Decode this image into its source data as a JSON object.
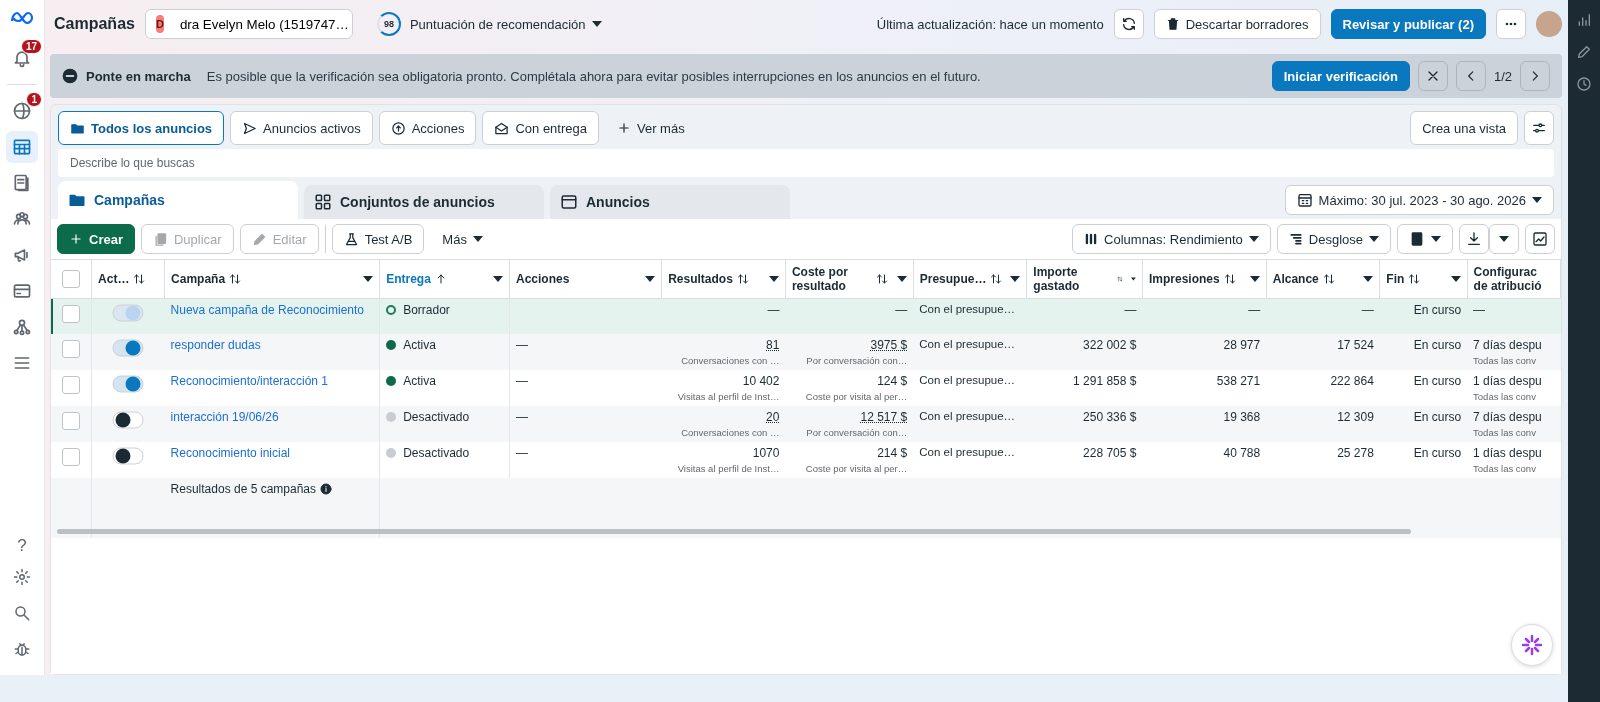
{
  "sidebar": {
    "items": [
      {
        "badge": "17",
        "selected": false
      },
      {
        "badge": "1",
        "selected": false
      },
      {
        "selected": true
      },
      {
        "selected": false
      },
      {
        "selected": false
      },
      {
        "selected": false
      },
      {
        "selected": false
      },
      {
        "selected": false
      },
      {
        "selected": false
      }
    ],
    "help_label": "?"
  },
  "header": {
    "title": "Campañas",
    "account": {
      "badge": "D",
      "name": "dra Evelyn Melo (1519747…"
    },
    "score": "98",
    "score_label": "Puntuación de recomendación",
    "updated": "Última actualización: hace un momento",
    "discard": "Descartar borradores",
    "publish": "Revisar y publicar (2)"
  },
  "banner": {
    "title": "Ponte en marcha",
    "message": "Es posible que la verificación sea obligatoria pronto. Complétala ahora para evitar posibles interrupciones en los anuncios en el futuro.",
    "action": "Iniciar verificación",
    "pager": "1/2"
  },
  "view_tabs": [
    {
      "label": "Todos los anuncios",
      "selected": true
    },
    {
      "label": "Anuncios activos",
      "selected": false
    },
    {
      "label": "Acciones",
      "selected": false
    },
    {
      "label": "Con entrega",
      "selected": false
    }
  ],
  "see_more": "Ver más",
  "create_view": "Crea una vista",
  "search": {
    "placeholder": "Describe lo que buscas"
  },
  "level_tabs": [
    {
      "label": "Campañas",
      "selected": true
    },
    {
      "label": "Conjuntos de anuncios",
      "selected": false
    },
    {
      "label": "Anuncios",
      "selected": false
    }
  ],
  "date_range": "Máximo: 30 jul. 2023 - 30 ago. 2026",
  "toolbar": {
    "create": "Crear",
    "buttons": [
      {
        "label": "Duplicar",
        "disabled": true
      },
      {
        "label": "Editar",
        "disabled": true
      },
      {
        "label": "Test A/B",
        "disabled": false
      }
    ],
    "more": "Más",
    "columns": "Columnas: Rendimiento",
    "breakdown": "Desglose"
  },
  "table": {
    "select_all_checked": false,
    "columns": [
      {
        "label": "Act…",
        "sorted": false
      },
      {
        "label": "Campaña",
        "sorted": false
      },
      {
        "label": "Entrega",
        "sorted": true
      },
      {
        "label": "Acciones",
        "sorted": false
      },
      {
        "label": "Resultados",
        "sorted": false
      },
      {
        "label": "Coste por resultado",
        "sorted": false
      },
      {
        "label": "Presupue…",
        "sorted": false
      },
      {
        "label": "Importe gastado",
        "sorted": false
      },
      {
        "label": "Impresiones",
        "sorted": false
      },
      {
        "label": "Alcance",
        "sorted": false
      },
      {
        "label": "Fin",
        "sorted": false
      },
      {
        "label": "Configurac de atribució",
        "sorted": false
      }
    ],
    "rows": [
      {
        "highlighted": true,
        "checked": false,
        "on": true,
        "draft": true,
        "name": "Nueva campaña de Reconocimiento",
        "status": "Borrador",
        "hollow_dot": true,
        "color": "#1e7a5a",
        "actions": "",
        "results": {
          "value": "—",
          "underlined": false
        },
        "cost": {
          "value": "—",
          "underlined": false
        },
        "budget": "Con el presupue…",
        "spent": "—",
        "impressions": "—",
        "reach": "—",
        "end": "En curso",
        "attribution": {
          "value": "—"
        }
      },
      {
        "highlighted": false,
        "checked": false,
        "on": true,
        "draft": false,
        "name": "responder dudas",
        "status": "Activa",
        "hollow_dot": false,
        "color": "#0a6b4a",
        "actions": "—",
        "results": {
          "value": "81",
          "note": "Conversaciones con …",
          "underlined": true
        },
        "cost": {
          "value": "3975 $",
          "note": "Por conversación con…",
          "underlined": true
        },
        "budget": "Con el presupue…",
        "spent": "322 002 $",
        "impressions": "28 977",
        "reach": "17 524",
        "end": "En curso",
        "attribution": {
          "value": "7 días despu",
          "note": "Todas las conv"
        }
      },
      {
        "highlighted": false,
        "checked": false,
        "on": true,
        "draft": false,
        "name": "Reconocimiento/interacción 1",
        "status": "Activa",
        "hollow_dot": false,
        "color": "#0a6b4a",
        "actions": "—",
        "results": {
          "value": "10 402",
          "note": "Visitas al perfil de Inst…",
          "underlined": false
        },
        "cost": {
          "value": "124 $",
          "note": "Coste por visita al per…",
          "underlined": false
        },
        "budget": "Con el presupue…",
        "spent": "1 291 858 $",
        "impressions": "538 271",
        "reach": "222 864",
        "end": "En curso",
        "attribution": {
          "value": "1 días despu",
          "note": "Todas las conv"
        }
      },
      {
        "highlighted": false,
        "checked": false,
        "on": false,
        "draft": false,
        "name": "interacción 19/06/26",
        "status": "Desactivado",
        "hollow_dot": false,
        "color": "#c9ccd1",
        "actions": "—",
        "results": {
          "value": "20",
          "note": "Conversaciones con …",
          "underlined": true
        },
        "cost": {
          "value": "12 517 $",
          "note": "Por conversación con…",
          "underlined": true
        },
        "budget": "Con el presupue…",
        "spent": "250 336 $",
        "impressions": "19 368",
        "reach": "12 309",
        "end": "En curso",
        "attribution": {
          "value": "7 días despu",
          "note": "Todas las conv"
        }
      },
      {
        "highlighted": false,
        "checked": false,
        "on": false,
        "draft": false,
        "name": "Reconocimiento inicial",
        "status": "Desactivado",
        "hollow_dot": false,
        "color": "#c9ccd1",
        "actions": "—",
        "results": {
          "value": "1070",
          "note": "Visitas al perfil de Inst…",
          "underlined": false
        },
        "cost": {
          "value": "214 $",
          "note": "Coste por visita al per…",
          "underlined": false
        },
        "budget": "Con el presupue…",
        "spent": "228 705 $",
        "impressions": "40 788",
        "reach": "25 278",
        "end": "En curso",
        "attribution": {
          "value": "1 días despu",
          "note": "Todas las conv"
        }
      }
    ],
    "summary": "Resultados de 5 campañas"
  }
}
